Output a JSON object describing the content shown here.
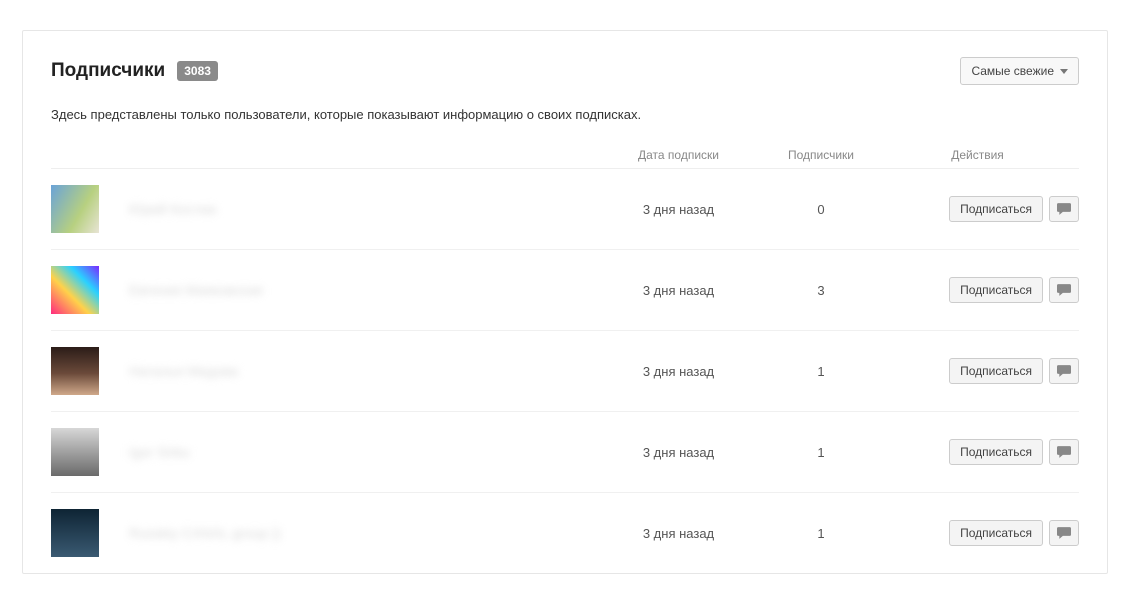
{
  "header": {
    "title": "Подписчики",
    "count": "3083",
    "sort_label": "Самые свежие"
  },
  "subtitle": "Здесь представлены только пользователи, которые показывают информацию о своих подписках.",
  "columns": {
    "date": "Дата подписки",
    "subs": "Подписчики",
    "actions": "Действия"
  },
  "actions": {
    "subscribe": "Подписаться"
  },
  "rows": [
    {
      "name": "Юрий Костюк",
      "date": "3 дня назад",
      "subs": "0"
    },
    {
      "name": "Евгения Маяковская",
      "date": "3 дня назад",
      "subs": "3"
    },
    {
      "name": "Наталья Медова",
      "date": "3 дня назад",
      "subs": "1"
    },
    {
      "name": "Igor Sirbu",
      "date": "3 дня назад",
      "subs": "1"
    },
    {
      "name": "Russkiy CANAL group ))",
      "date": "3 дня назад",
      "subs": "1"
    }
  ]
}
